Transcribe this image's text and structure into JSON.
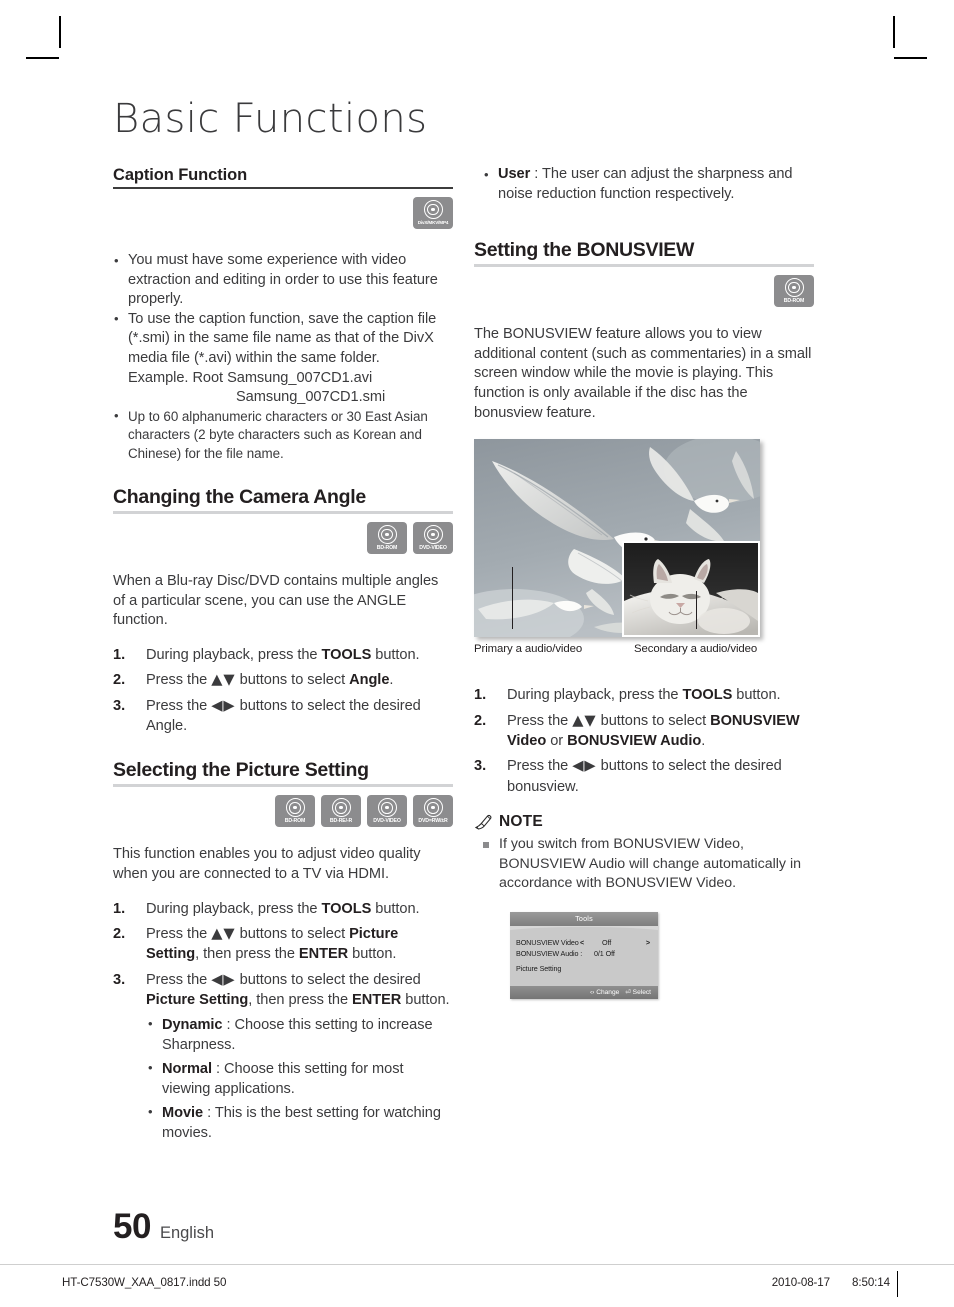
{
  "page": {
    "title": "Basic Functions",
    "number": "50",
    "language": "English"
  },
  "left_column": {
    "caption_function": {
      "heading": "Caption Function",
      "badges": [
        {
          "label": "DivX/MKV/MP4",
          "icon": "disc-icon"
        }
      ],
      "bullets": [
        "You must have some experience with video extraction and editing in order to use this feature properly.",
        "To use the caption function, save the caption file (*.smi) in the same file name as that of the DivX media file (*.avi) within the same folder.",
        "Up to 60 alphanumeric characters or 30 East Asian characters (2 byte characters such as Korean and Chinese) for the file name."
      ],
      "example_line_1": "Example. Root Samsung_007CD1.avi",
      "example_line_2": "Samsung_007CD1.smi"
    },
    "camera_angle": {
      "heading": "Changing the Camera Angle",
      "badges": [
        {
          "label": "BD-ROM",
          "icon": "disc-icon"
        },
        {
          "label": "DVD-VIDEO",
          "icon": "disc-icon"
        }
      ],
      "intro": "When a Blu-ray Disc/DVD contains multiple angles of a particular scene, you can use the ANGLE function.",
      "steps": [
        {
          "pre": "During playback, press the ",
          "bold": "TOOLS",
          "post": " button."
        },
        {
          "pre": "Press the ",
          "arrows": "▲▼",
          "mid": " buttons to select ",
          "bold": "Angle",
          "post": "."
        },
        {
          "pre": "Press the ",
          "arrows": "◀▶",
          "mid": " buttons to select the desired Angle.",
          "bold": "",
          "post": ""
        }
      ]
    },
    "picture_setting": {
      "heading": "Selecting the Picture Setting",
      "badges": [
        {
          "label": "BD-ROM",
          "icon": "disc-icon"
        },
        {
          "label": "BD-RE/-R",
          "icon": "disc-icon"
        },
        {
          "label": "DVD-VIDEO",
          "icon": "disc-icon"
        },
        {
          "label": "DVD=RW/±R",
          "icon": "disc-icon"
        }
      ],
      "intro": "This function enables you to adjust video quality when you are connected to a TV via HDMI.",
      "step1": {
        "pre": "During playback, press the ",
        "bold": "TOOLS",
        "post": " button."
      },
      "step2": {
        "pre": "Press the ",
        "arrows": "▲▼",
        "mid": " buttons to select ",
        "bold": "Picture Setting",
        "mid2": ", then press the ",
        "bold2": "ENTER",
        "post": " button."
      },
      "step3": {
        "pre": "Press the ",
        "arrows": "◀▶",
        "mid": " buttons to select the desired ",
        "bold": "Picture Setting",
        "mid2": ", then press the ",
        "bold2": "ENTER",
        "post": " button."
      },
      "options": [
        {
          "name": "Dynamic",
          "desc": " : Choose this setting to increase Sharpness."
        },
        {
          "name": "Normal",
          "desc": " : Choose this setting for most viewing applications."
        },
        {
          "name": "Movie",
          "desc": " : This is the best setting for watching movies."
        }
      ]
    }
  },
  "right_column": {
    "user_option": {
      "name": "User",
      "desc": " : The user can adjust the sharpness and noise reduction function respectively."
    },
    "bonusview": {
      "heading": "Setting the BONUSVIEW",
      "badges": [
        {
          "label": "BD-ROM",
          "icon": "disc-icon"
        }
      ],
      "intro": "The BONUSVIEW feature allows you to view additional content (such as commentaries) in a small screen window while the movie is playing. This function is only available if the disc has the bonusview feature.",
      "figure": {
        "caption_primary": "Primary a audio/video",
        "caption_secondary": "Secondary a audio/video"
      },
      "step1": {
        "pre": "During playback, press the ",
        "bold": "TOOLS",
        "post": " button."
      },
      "step2": {
        "pre": "Press the ",
        "arrows": "▲▼",
        "mid": " buttons to select ",
        "bold": "BONUSVIEW Video",
        "mid2": " or ",
        "bold2": "BONUSVIEW Audio",
        "post": "."
      },
      "step3": {
        "pre": "Press the ",
        "arrows": "◀▶",
        "mid": " buttons to select the desired bonusview.",
        "bold": "",
        "post": ""
      },
      "note": {
        "heading": "NOTE",
        "icon": "pencil-icon",
        "items": [
          "If you switch from BONUSVIEW Video, BONUSVIEW Audio will change automatically in accordance with BONUSVIEW Video."
        ]
      },
      "osd": {
        "title": "Tools",
        "rows": [
          {
            "label": "BONUSVIEW Video",
            "left_arrow": "<",
            "value": "Off",
            "right_arrow": ">"
          },
          {
            "label": "BONUSVIEW Audio :",
            "value": "0/1 Off"
          },
          {
            "label": "Picture Setting"
          }
        ],
        "footer_change": "Change",
        "footer_select": "Select",
        "footer_change_icon": "‹›",
        "footer_select_icon": "⏎"
      }
    }
  },
  "footer": {
    "filename": "HT-C7530W_XAA_0817.indd   50",
    "date": "2010-08-17",
    "time": "8:50:14"
  },
  "colors": {
    "badge_gray": "#8c8c8e",
    "heading_rule": "#d2d3d5",
    "text": "#3b3b3d"
  }
}
